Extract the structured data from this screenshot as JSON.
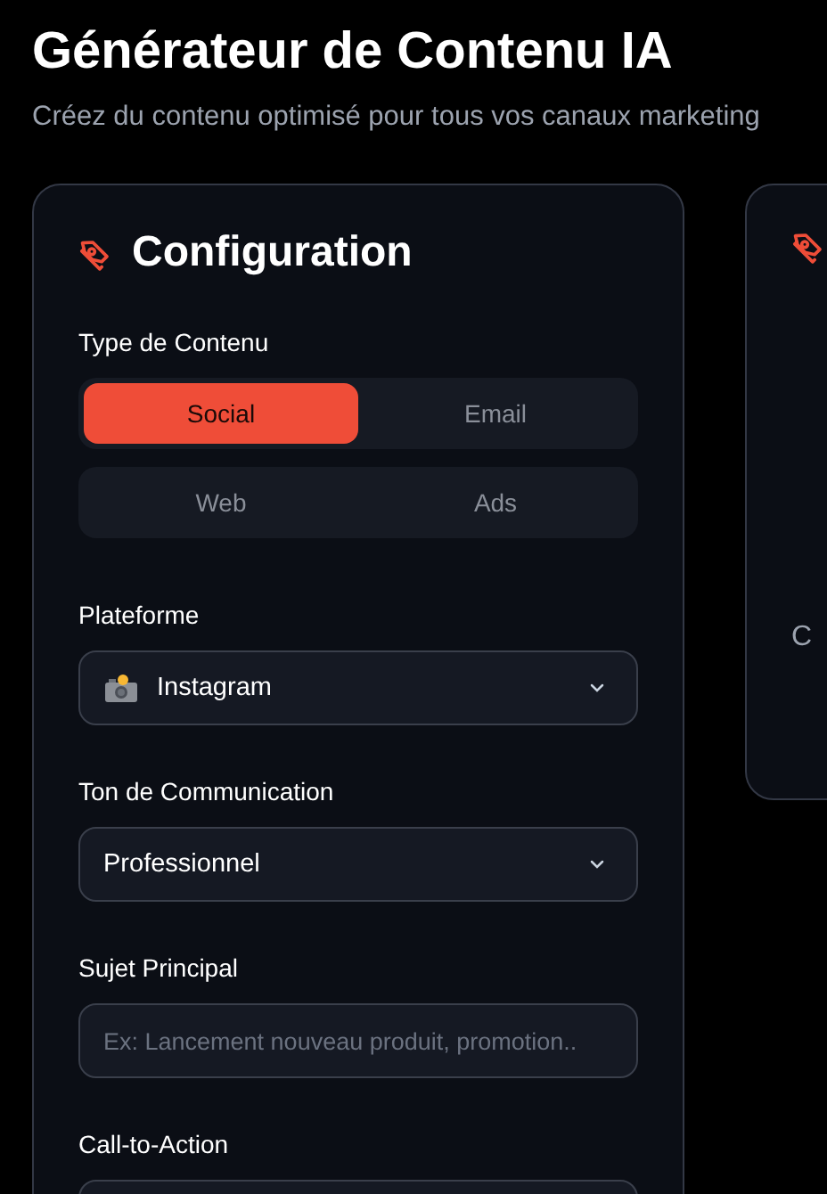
{
  "header": {
    "title": "Générateur de Contenu IA",
    "subtitle": "Créez du contenu optimisé pour tous vos canaux marketing"
  },
  "config_panel": {
    "title": "Configuration",
    "content_type_label": "Type de Contenu",
    "content_type_rows": [
      {
        "options": [
          {
            "label": "Social",
            "selected": true
          },
          {
            "label": "Email",
            "selected": false
          }
        ]
      },
      {
        "options": [
          {
            "label": "Web",
            "selected": false
          },
          {
            "label": "Ads",
            "selected": false
          }
        ]
      }
    ],
    "fields": [
      {
        "kind": "platform_select",
        "label": "Plateforme",
        "value": "Instagram"
      },
      {
        "kind": "select",
        "label": "Ton de Communication",
        "value": "Professionnel"
      },
      {
        "kind": "input",
        "label": "Sujet Principal",
        "placeholder": "Ex: Lancement nouveau produit, promotion.."
      },
      {
        "kind": "input",
        "label": "Call-to-Action"
      }
    ]
  },
  "output_panel": {
    "text": "C"
  }
}
